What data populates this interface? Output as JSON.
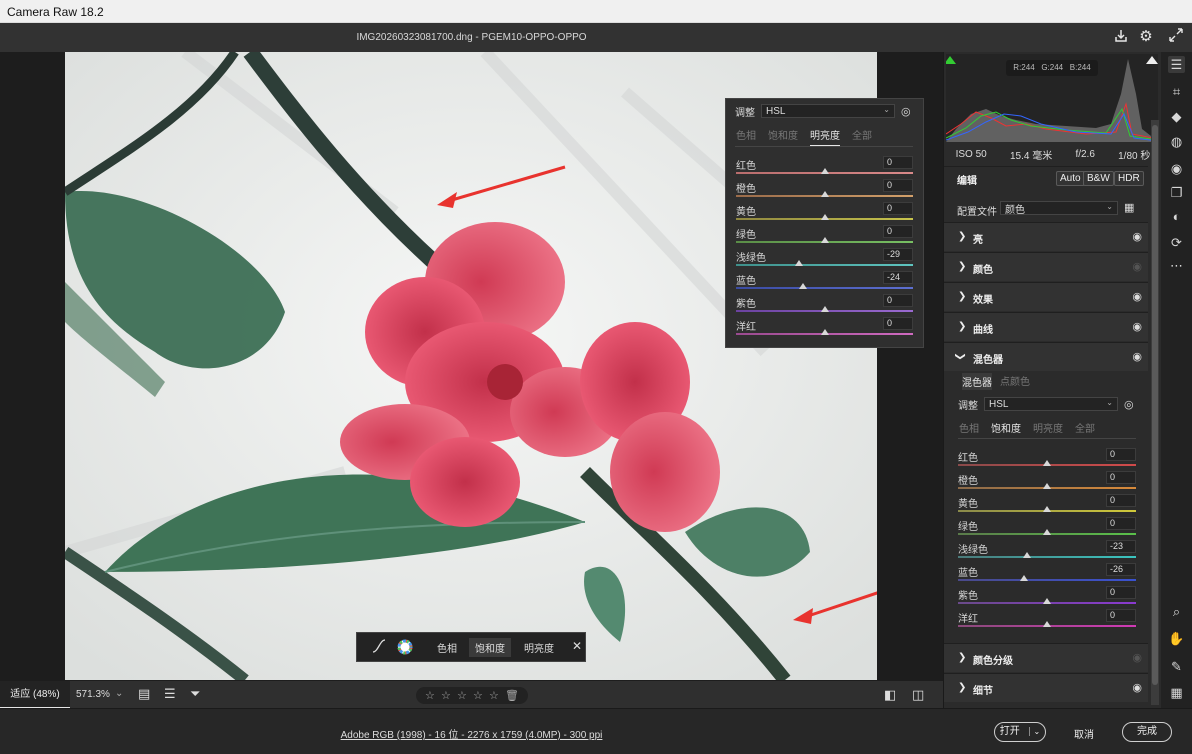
{
  "window": {
    "title": "Camera Raw 18.2"
  },
  "header": {
    "filename": "IMG20260323081700.dng - PGEM10-OPPO-OPPO"
  },
  "float_panel": {
    "adjust_label": "调整",
    "mode_value": "HSL",
    "tabs": [
      "色相",
      "饱和度",
      "明亮度",
      "全部"
    ],
    "active_tab": "明亮度",
    "sliders": [
      {
        "label": "红色",
        "value": "0",
        "pos": 0.5,
        "gradient": [
          "#b96d6d",
          "#d98a8a"
        ]
      },
      {
        "label": "橙色",
        "value": "0",
        "pos": 0.5,
        "gradient": [
          "#9a6b4a",
          "#d2a06a"
        ]
      },
      {
        "label": "黄色",
        "value": "0",
        "pos": 0.5,
        "gradient": [
          "#8f8740",
          "#c8c44c"
        ]
      },
      {
        "label": "绿色",
        "value": "0",
        "pos": 0.5,
        "gradient": [
          "#5a8d47",
          "#78c063"
        ]
      },
      {
        "label": "浅绿色",
        "value": "-29",
        "pos": 0.355,
        "gradient": [
          "#3e8f8a",
          "#5fc5c0"
        ]
      },
      {
        "label": "蓝色",
        "value": "-24",
        "pos": 0.38,
        "gradient": [
          "#3a4ba2",
          "#5d6fd0"
        ]
      },
      {
        "label": "紫色",
        "value": "0",
        "pos": 0.5,
        "gradient": [
          "#6b42a0",
          "#9a6ad0"
        ]
      },
      {
        "label": "洋红",
        "value": "0",
        "pos": 0.5,
        "gradient": [
          "#9a4a8f",
          "#cf6ac0"
        ]
      }
    ]
  },
  "histogram": {
    "r": "R:244",
    "g": "G:244",
    "b": "B:244"
  },
  "exif": {
    "iso": "ISO 50",
    "focal": "15.4 毫米",
    "aperture": "f/2.6",
    "shutter": "1/80 秒"
  },
  "edit": {
    "title": "编辑",
    "auto": "Auto",
    "bw": "B&W",
    "hdr": "HDR",
    "profile_label": "配置文件",
    "profile_value": "颜色"
  },
  "sections": {
    "light": "亮",
    "color": "颜色",
    "effects": "效果",
    "curve": "曲线",
    "mixer": "混色器",
    "grading": "颜色分级",
    "detail": "细节"
  },
  "mixer": {
    "subtabs": [
      "混色器",
      "点颜色"
    ],
    "adjust_label": "调整",
    "mode_value": "HSL",
    "tabs": [
      "色相",
      "饱和度",
      "明亮度",
      "全部"
    ],
    "active_tab": "饱和度",
    "sliders": [
      {
        "label": "红色",
        "value": "0",
        "pos": 0.5,
        "gradient": [
          "#8a4a4a",
          "#d14a4a"
        ]
      },
      {
        "label": "橙色",
        "value": "0",
        "pos": 0.5,
        "gradient": [
          "#8a6a4a",
          "#d88a3a"
        ]
      },
      {
        "label": "黄色",
        "value": "0",
        "pos": 0.5,
        "gradient": [
          "#8a8a4a",
          "#d0c93a"
        ]
      },
      {
        "label": "绿色",
        "value": "0",
        "pos": 0.5,
        "gradient": [
          "#5a7a4a",
          "#5ac04a"
        ]
      },
      {
        "label": "浅绿色",
        "value": "-23",
        "pos": 0.385,
        "gradient": [
          "#4a7a7a",
          "#3ac5c0"
        ]
      },
      {
        "label": "蓝色",
        "value": "-26",
        "pos": 0.37,
        "gradient": [
          "#4a4a8a",
          "#3a52d0"
        ]
      },
      {
        "label": "紫色",
        "value": "0",
        "pos": 0.5,
        "gradient": [
          "#6a4a8a",
          "#8a3ad0"
        ]
      },
      {
        "label": "洋红",
        "value": "0",
        "pos": 0.5,
        "gradient": [
          "#8a4a7a",
          "#d03ab5"
        ]
      }
    ]
  },
  "bottom_bar": {
    "fit": "适应 (48%)",
    "zoom": "571.3%"
  },
  "mini_toolbar": {
    "hue": "色相",
    "saturation": "饱和度",
    "luminance": "明亮度"
  },
  "status": {
    "file_info": "Adobe RGB (1998) - 16 位 - 2276 x 1759 (4.0MP) - 300 ppi",
    "open": "打开",
    "cancel": "取消",
    "done": "完成"
  },
  "colors": {
    "accent_arrow": "#e8332e",
    "panel_bg": "#2b2b2b"
  },
  "icons": [
    "save-icon",
    "settings-icon",
    "fullscreen-icon",
    "edit-tool-icon",
    "crop-icon",
    "eraser-icon",
    "mask-icon",
    "redeye-icon",
    "snapshot-icon",
    "presets-icon",
    "more-icon",
    "zoom-icon",
    "hand-icon",
    "sampler-icon",
    "grid-icon"
  ]
}
